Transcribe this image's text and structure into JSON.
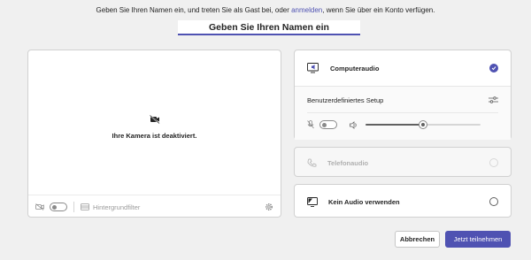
{
  "intro": {
    "before": "Geben Sie Ihren Namen ein, und treten Sie als Gast bei, oder ",
    "link": "anmelden",
    "after": ", wenn Sie über ein Konto verfügen."
  },
  "name_input": {
    "placeholder": "Geben Sie Ihren Namen ein",
    "value": ""
  },
  "video": {
    "camera_off_message": "Ihre Kamera ist deaktiviert.",
    "camera_toggle_on": false,
    "background_filter_label": "Hintergrundfilter"
  },
  "audio": {
    "computer": {
      "label": "Computeraudio",
      "selected": true
    },
    "custom_setup": {
      "label": "Benutzerdefiniertes Setup",
      "mic_on": false,
      "volume_level": 0.5
    },
    "phone": {
      "label": "Telefonaudio",
      "disabled": true
    },
    "none": {
      "label": "Kein Audio verwenden",
      "selected": false
    }
  },
  "actions": {
    "cancel": "Abbrechen",
    "join": "Jetzt teilnehmen"
  },
  "colors": {
    "accent": "#4f52b2",
    "background": "#f0f0f0"
  }
}
